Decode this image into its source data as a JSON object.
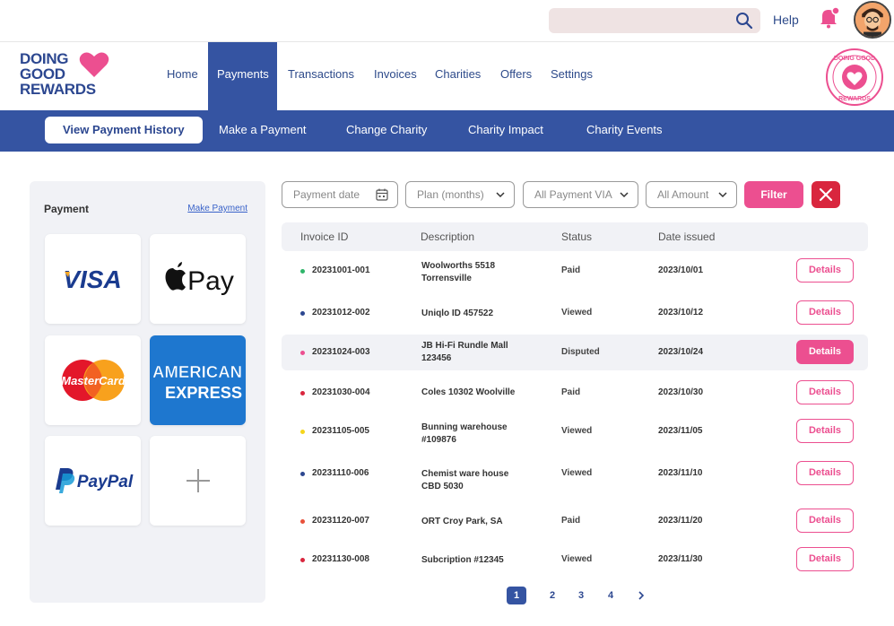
{
  "header": {
    "search_placeholder": "",
    "help": "Help"
  },
  "logo": {
    "line1": "DOING",
    "line2": "GOOD",
    "line3": "REWARDS",
    "registered": "®"
  },
  "badge": {
    "text_top": "DOING GOOD",
    "text_bottom": "REWARDS"
  },
  "nav": [
    {
      "label": "Home"
    },
    {
      "label": "Payments",
      "active": true
    },
    {
      "label": "Transactions"
    },
    {
      "label": "Invoices"
    },
    {
      "label": "Charities"
    },
    {
      "label": "Offers"
    },
    {
      "label": "Settings"
    }
  ],
  "subnav": [
    {
      "label": "View Payment History",
      "active": true
    },
    {
      "label": "Make a Payment"
    },
    {
      "label": "Change Charity"
    },
    {
      "label": "Charity Impact"
    },
    {
      "label": "Charity Events"
    }
  ],
  "payment_panel": {
    "title": "Payment",
    "link": "Make Payment",
    "cards": [
      {
        "name": "VISA",
        "icon": "visa-logo"
      },
      {
        "name": "Pay",
        "icon": "apple-pay-logo"
      },
      {
        "name": "MasterCard",
        "icon": "mastercard-logo"
      },
      {
        "name": "AMERICAN EXPRESS",
        "line1": "AMERICAN",
        "line2": "EXPRESS",
        "icon": "amex-logo"
      },
      {
        "name": "PayPal",
        "icon": "paypal-logo"
      },
      {
        "name": "+",
        "icon": "add-icon"
      }
    ]
  },
  "filters": {
    "payment_date": "Payment date",
    "plan": "Plan (months)",
    "via": "All Payment VIA",
    "amount": "All Amount",
    "filter_button": "Filter"
  },
  "table": {
    "headers": [
      "Invoice ID",
      "Description",
      "Status",
      "Date issued"
    ],
    "rows": [
      {
        "id": "20231001-001",
        "desc1": "Woolworths 5518",
        "desc2": "Torrensville",
        "status": "Paid",
        "date": "2023/10/01",
        "dot": "#2fb56a",
        "action": "Details"
      },
      {
        "id": "20231012-002",
        "desc1": "Uniqlo ID 457522",
        "desc2": "",
        "status": "Viewed",
        "date": "2023/10/12",
        "dot": "#2c4790",
        "action": "Details"
      },
      {
        "id": "20231024-003",
        "desc1": "JB Hi-Fi Rundle Mall",
        "desc2": "123456",
        "status": "Disputed",
        "date": "2023/10/24",
        "dot": "#ec4f90",
        "action": "Details",
        "highlight": true
      },
      {
        "id": "20231030-004",
        "desc1": "Coles 10302 Woolville",
        "desc2": "",
        "status": "Paid",
        "date": "2023/10/30",
        "dot": "#d9263e",
        "action": "Details"
      },
      {
        "id": "20231105-005",
        "desc1": "Bunning warehouse",
        "desc2": "#109876",
        "status": "Viewed",
        "date": "2023/11/05",
        "dot": "#f5d51c",
        "action": "Details"
      },
      {
        "id": "20231110-006",
        "desc1": "Chemist ware house",
        "desc2": "CBD 5030",
        "status": "Viewed",
        "date": "2023/11/10",
        "dot": "#2c4790",
        "action": "Details"
      },
      {
        "id": "20231120-007",
        "desc1": "ORT Croy Park, SA",
        "desc2": "",
        "status": "Paid",
        "date": "2023/11/20",
        "dot": "#e8503a",
        "action": "Details"
      },
      {
        "id": "20231130-008",
        "desc1": "Subcription #12345",
        "desc2": "",
        "status": "Viewed",
        "date": "2023/11/30",
        "dot": "#d9263e",
        "action": "Details"
      }
    ]
  },
  "pagination": {
    "pages": [
      "1",
      "2",
      "3",
      "4"
    ],
    "current": "1"
  },
  "colors": {
    "brand_blue": "#3554a2",
    "brand_pink": "#ec4f90",
    "danger": "#d9263e"
  }
}
